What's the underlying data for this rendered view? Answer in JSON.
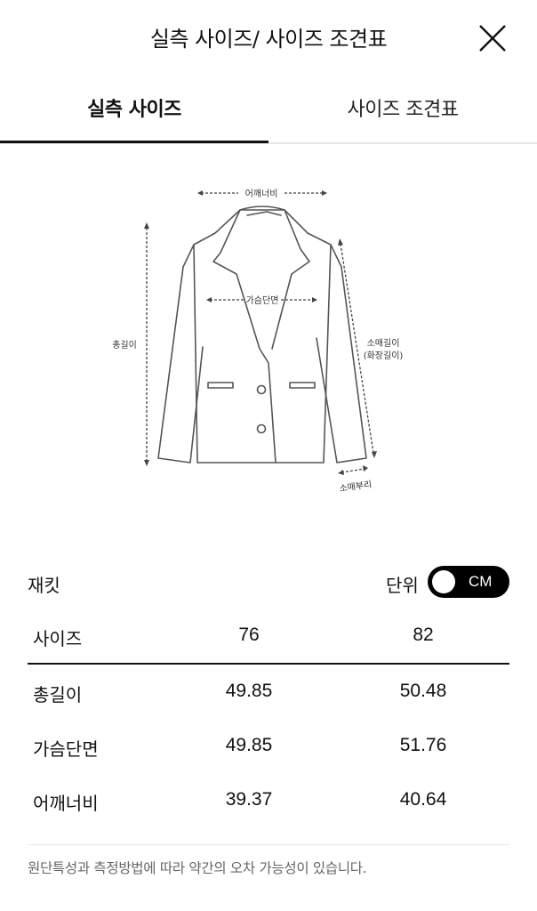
{
  "header": {
    "title": "실측 사이즈/ 사이즈 조견표"
  },
  "tabs": [
    {
      "label": "실측 사이즈",
      "active": true
    },
    {
      "label": "사이즈 조견표",
      "active": false
    }
  ],
  "diagram": {
    "labels": {
      "shoulder_width": "어깨너비",
      "chest": "가슴단면",
      "total_length": "총길이",
      "sleeve_length_line1": "소매길이",
      "sleeve_length_line2": "(화장길이)",
      "cuff": "소매부리"
    }
  },
  "table": {
    "product": "재킷",
    "unit_label": "단위",
    "unit_value": "CM",
    "columns": [
      "사이즈",
      "76",
      "82"
    ],
    "rows": [
      [
        "총길이",
        "49.85",
        "50.48"
      ],
      [
        "가슴단면",
        "49.85",
        "51.76"
      ],
      [
        "어깨너비",
        "39.37",
        "40.64"
      ]
    ]
  },
  "footnote": "원단특성과 측정방법에 따라 약간의 오차 가능성이 있습니다."
}
